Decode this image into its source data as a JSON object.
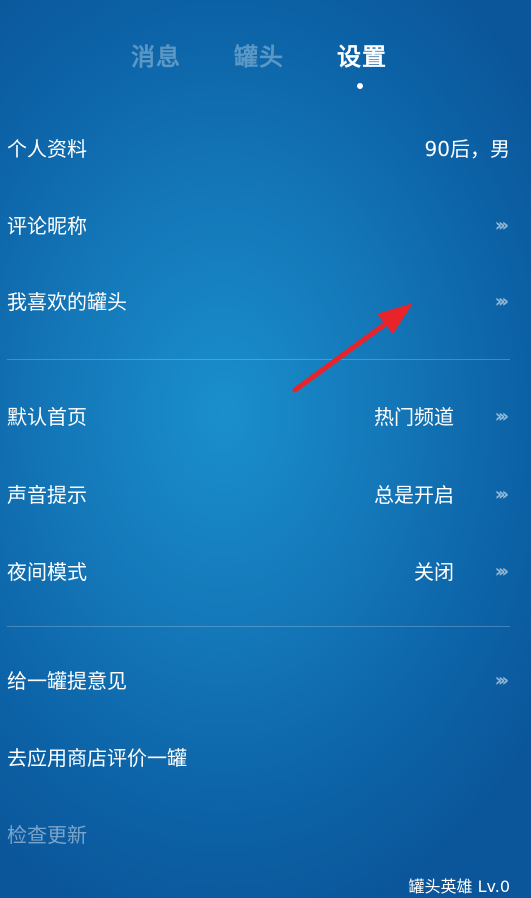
{
  "tabs": [
    {
      "label": "消息",
      "active": false
    },
    {
      "label": "罐头",
      "active": false
    },
    {
      "label": "设置",
      "active": true
    }
  ],
  "settings": {
    "profile": {
      "label": "个人资料",
      "value": "90后，男"
    },
    "nickname": {
      "label": "评论昵称",
      "arrow": "›››"
    },
    "favorites": {
      "label": "我喜欢的罐头",
      "arrow": "›››"
    },
    "default_page": {
      "label": "默认首页",
      "value": "热门频道",
      "arrow": "›››"
    },
    "sound": {
      "label": "声音提示",
      "value": "总是开启",
      "arrow": "›››"
    },
    "night_mode": {
      "label": "夜间模式",
      "value": "关闭",
      "arrow": "›››"
    },
    "feedback": {
      "label": "给一罐提意见",
      "arrow": "›››"
    },
    "rate": {
      "label": "去应用商店评价一罐"
    },
    "update": {
      "label": "检查更新"
    }
  },
  "footer": {
    "level": "罐头英雄 Lv.0"
  },
  "colors": {
    "background": "#1478b9",
    "annotation_arrow": "#e8232a",
    "active_tab": "#ffffff",
    "inactive_tab": "#7fb3d6"
  },
  "icons": {
    "row_chevrons": "triple-chevron-right-icon",
    "tab_indicator": "dot-icon",
    "annotation": "red-arrow-icon"
  }
}
